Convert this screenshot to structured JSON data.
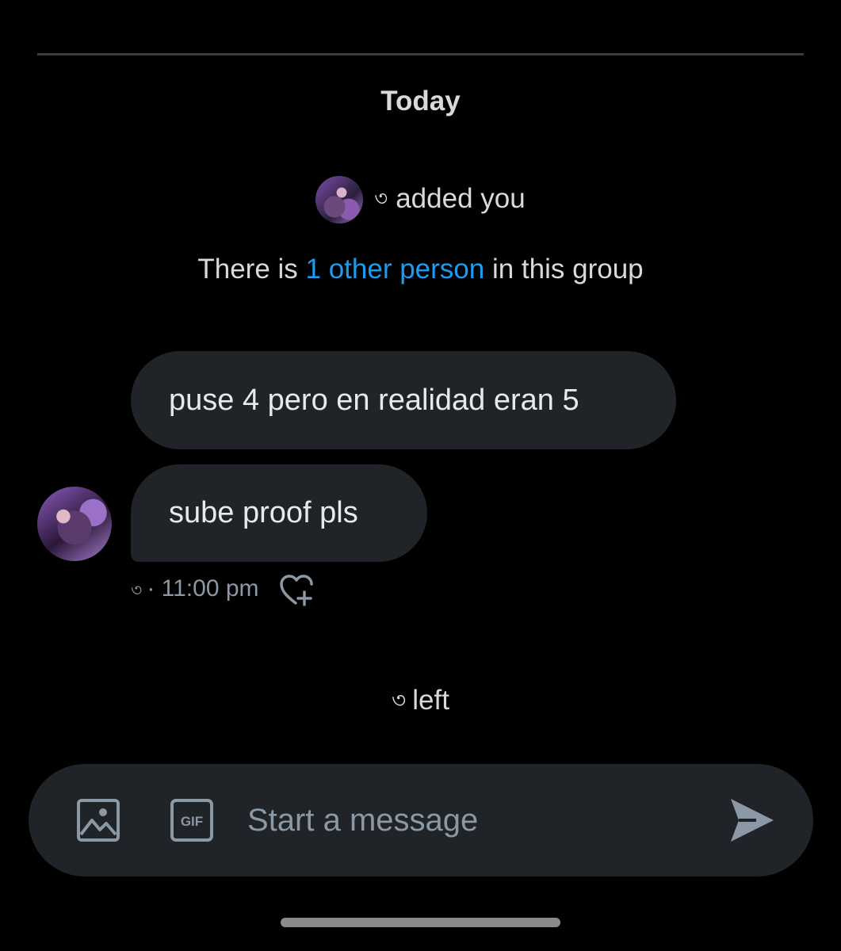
{
  "conversation": {
    "date_separator": "Today",
    "added_event": {
      "name_glyph": "৩",
      "text": "added you"
    },
    "group_info": {
      "prefix": "There is ",
      "link_text": "1 other person",
      "suffix": " in this group"
    },
    "messages": [
      {
        "text": "puse 4 pero en realidad eran 5"
      },
      {
        "text": "sube proof pls"
      }
    ],
    "meta": {
      "sender_glyph": "৩",
      "separator": "·",
      "time": "11:00 pm",
      "reaction_icon": "heart-plus-icon"
    },
    "left_event": {
      "name_glyph": "৩",
      "text": "left"
    }
  },
  "composer": {
    "placeholder": "Start a message",
    "media_icon": "image-icon",
    "gif_label": "GIF",
    "send_icon": "send-icon"
  },
  "colors": {
    "background": "#000000",
    "bubble": "#202327",
    "link": "#1d9bf0",
    "secondary_text": "#8b98a5"
  }
}
